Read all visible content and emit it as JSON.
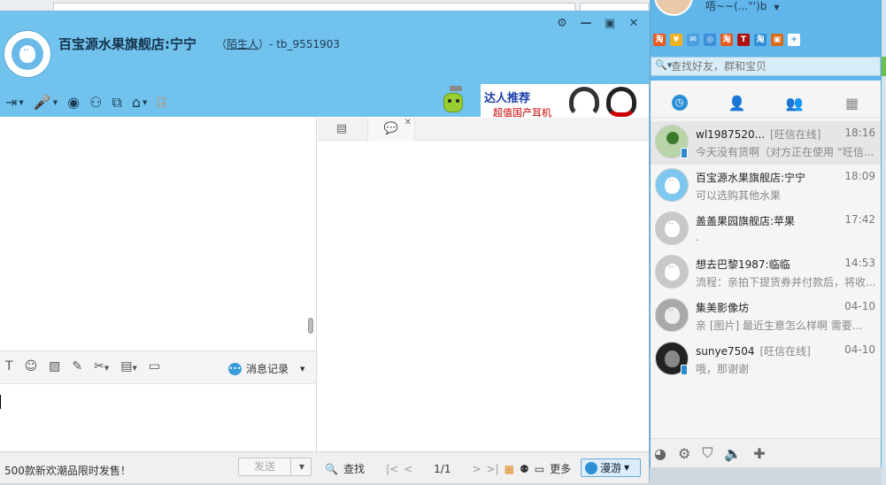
{
  "chat": {
    "contact_name": "百宝源水果旗舰店:宁宁",
    "relation_open": "（",
    "relation": "陌生人",
    "relation_close": "）",
    "account": "- tb_9551903",
    "banner_title": "达人推荐",
    "banner_sub": "超值国产耳机",
    "history_label": "消息记录",
    "promo_text": "500款新欢潮品限时发售！",
    "send_label": "发送",
    "find_label": "查找",
    "page": "1/1",
    "more_label": "更多",
    "roam_label": "漫游"
  },
  "main": {
    "status_text": "唔~~(",
    "status_tail": "...\"')b",
    "search_placeholder": "查找好友，群和宝贝",
    "conversations": [
      {
        "name": "wl1987520...",
        "status": "[旺信在线]",
        "time": "18:16",
        "preview": "今天没有货啊（对方正在使用 “旺信..."
      },
      {
        "name": "百宝源水果旗舰店:宁宁",
        "status": "",
        "time": "18:09",
        "preview": "可以选购其他水果"
      },
      {
        "name": "盖盖果园旗舰店:苹果",
        "status": "",
        "time": "17:42",
        "preview": "."
      },
      {
        "name": "想去巴黎1987:临临",
        "status": "",
        "time": "14:53",
        "preview": "流程：亲拍下提货券并付款后，将收..."
      },
      {
        "name": "集美影像坊",
        "status": "",
        "time": "04-10",
        "preview": "亲 [图片] 最近生意怎么样啊 需要..."
      },
      {
        "name": "sunye7504",
        "status": "[旺信在线]",
        "time": "04-10",
        "preview": "哦，那谢谢"
      }
    ]
  }
}
